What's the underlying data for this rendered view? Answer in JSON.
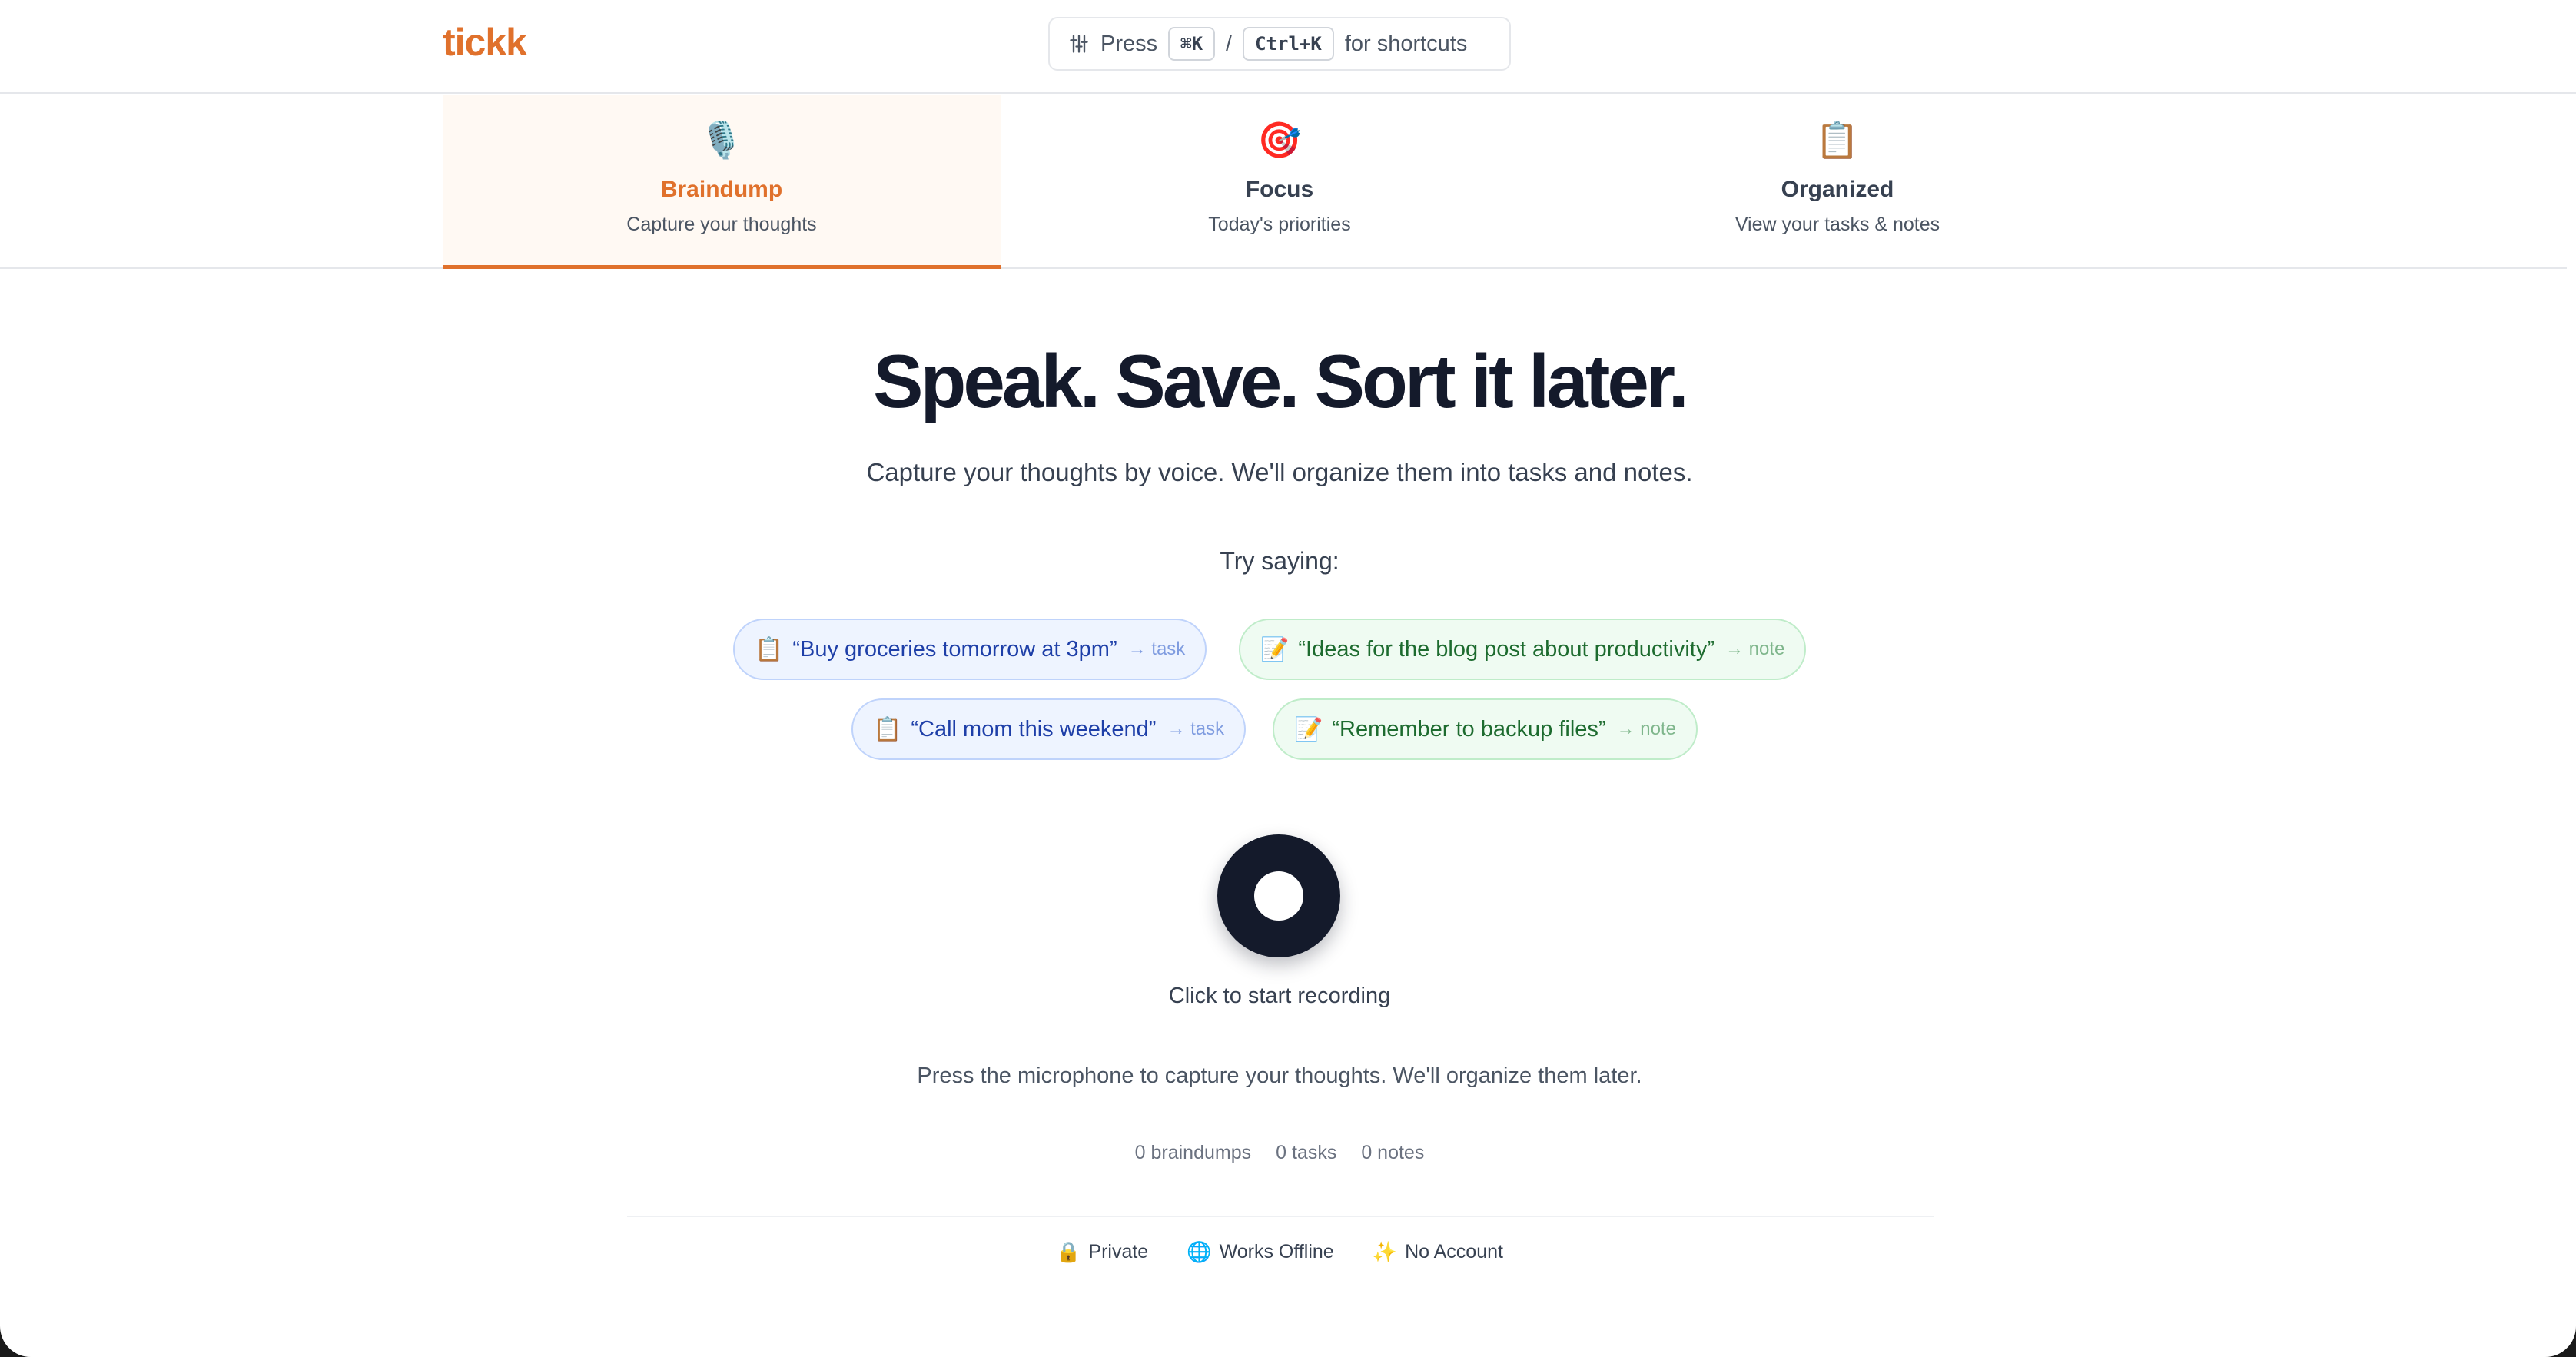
{
  "header": {
    "logo": "tickk",
    "shortcut": {
      "press": "Press",
      "mac_key": "⌘K",
      "separator": "/",
      "win_key": "Ctrl+K",
      "suffix": "for shortcuts"
    }
  },
  "tabs": [
    {
      "icon": "🎙️",
      "icon_name": "microphone-icon",
      "label": "Braindump",
      "sub": "Capture your thoughts",
      "active": true
    },
    {
      "icon": "🎯",
      "icon_name": "target-icon",
      "label": "Focus",
      "sub": "Today's priorities",
      "active": false
    },
    {
      "icon": "📋",
      "icon_name": "clipboard-icon",
      "label": "Organized",
      "sub": "View your tasks & notes",
      "active": false
    }
  ],
  "main": {
    "headline": "Speak. Save. Sort it later.",
    "subhead": "Capture your thoughts by voice. We'll organize them into tasks and notes.",
    "try_label": "Try saying:",
    "examples": [
      {
        "icon": "📋",
        "text": "“Buy groceries tomorrow at 3pm”",
        "tag": "→ task",
        "kind": "task"
      },
      {
        "icon": "📝",
        "text": "“Ideas for the blog post about productivity”",
        "tag": "→ note",
        "kind": "note"
      },
      {
        "icon": "📋",
        "text": "“Call mom this weekend”",
        "tag": "→ task",
        "kind": "task"
      },
      {
        "icon": "📝",
        "text": "“Remember to backup files”",
        "tag": "→ note",
        "kind": "note"
      }
    ],
    "record_label": "Click to start recording",
    "hint": "Press the microphone to capture your thoughts. We'll organize them later.",
    "stats": [
      "0 braindumps",
      "0 tasks",
      "0 notes"
    ]
  },
  "footer": [
    {
      "icon": "🔒",
      "icon_name": "lock-icon",
      "label": "Private"
    },
    {
      "icon": "🌐",
      "icon_name": "globe-icon",
      "label": "Works Offline"
    },
    {
      "icon": "✨",
      "icon_name": "sparkles-icon",
      "label": "No Account"
    }
  ],
  "colors": {
    "accent": "#e0712c",
    "headline": "#141a2b",
    "task_bg": "#eef4ff",
    "note_bg": "#effbf2"
  }
}
